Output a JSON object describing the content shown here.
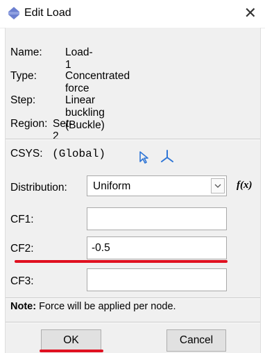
{
  "window": {
    "title": "Edit Load",
    "close_glyph": "✕"
  },
  "info": {
    "name_label": "Name:",
    "name_value": "Load-1",
    "type_label": "Type:",
    "type_value": "Concentrated force",
    "step_label": "Step:",
    "step_value": "Linear buckling (Buckle)",
    "region_label": "Region:",
    "region_value": "Set-2"
  },
  "csys": {
    "label": "CSYS:",
    "value": "(Global)",
    "icons": [
      "select-arrow-icon",
      "datum-csys-icon"
    ]
  },
  "distribution": {
    "label": "Distribution:",
    "selected": "Uniform",
    "fx_label": "f(x)"
  },
  "fields": [
    {
      "label": "CF1:",
      "value": ""
    },
    {
      "label": "CF2:",
      "value": "-0.5"
    },
    {
      "label": "CF3:",
      "value": ""
    }
  ],
  "note": {
    "bold": "Note:",
    "text": " Force will be applied per node."
  },
  "buttons": {
    "ok": "OK",
    "cancel": "Cancel"
  },
  "colors": {
    "highlight_underline": "#e01020",
    "dialog_bg": "#f0f0f0",
    "icon_blue": "#2e75d6"
  }
}
